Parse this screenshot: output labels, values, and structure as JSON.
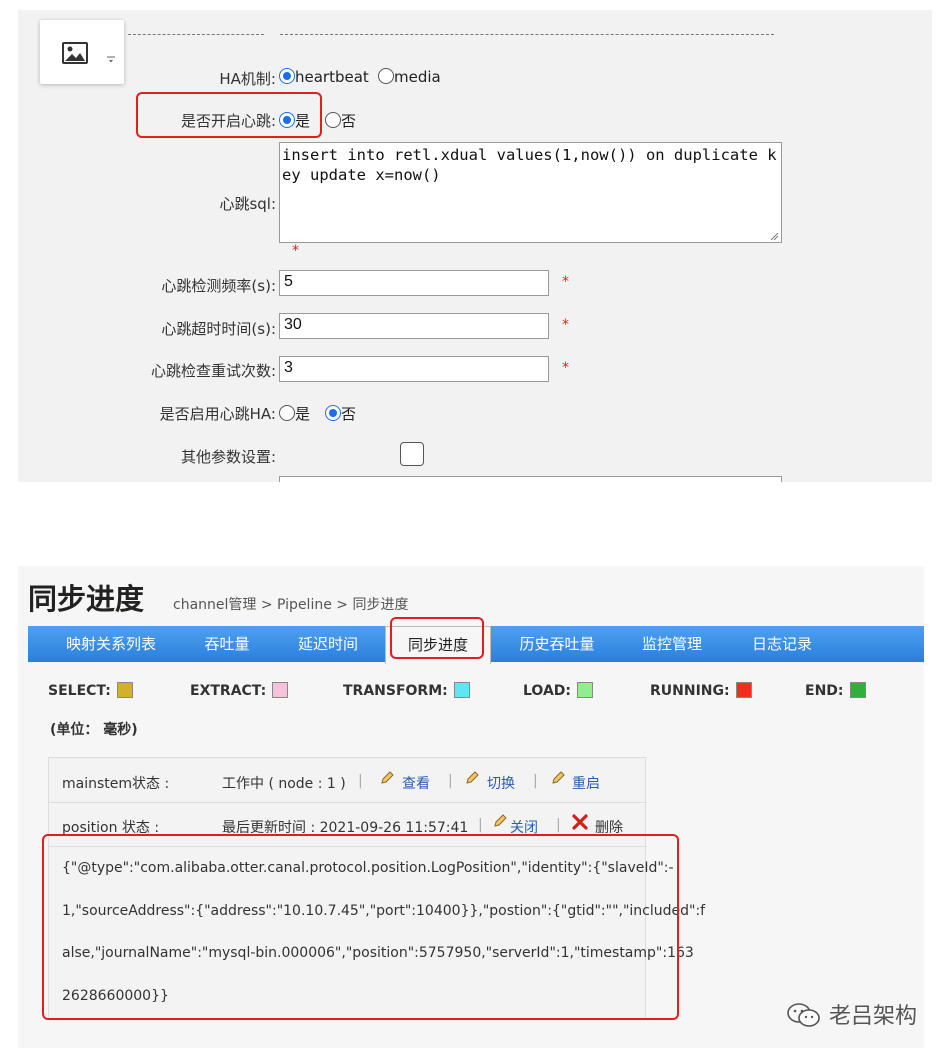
{
  "ha_form": {
    "ha_mechanism": {
      "label": "HA机制:",
      "options": [
        "heartbeat",
        "media"
      ],
      "selected": "heartbeat"
    },
    "enable_heartbeat": {
      "label": "是否开启心跳:",
      "options": [
        "是",
        "否"
      ],
      "selected": "是"
    },
    "heartbeat_sql": {
      "label": "心跳sql:",
      "value": "insert into retl.xdual values(1,now()) on duplicate key update x=now()"
    },
    "heartbeat_interval": {
      "label": "心跳检测频率(s):",
      "value": "5"
    },
    "heartbeat_timeout": {
      "label": "心跳超时时间(s):",
      "value": "30"
    },
    "heartbeat_retry": {
      "label": "心跳检查重试次数:",
      "value": "3"
    },
    "enable_heartbeat_ha": {
      "label": "是否启用心跳HA:",
      "options": [
        "是",
        "否"
      ],
      "selected": "否"
    },
    "other_params": {
      "label": "其他参数设置:",
      "checked": false
    },
    "required_mark": "*"
  },
  "page": {
    "title": "同步进度",
    "breadcrumb": "channel管理 > Pipeline > 同步进度"
  },
  "tabs": [
    {
      "label": "映射关系列表",
      "active": false
    },
    {
      "label": "吞吐量",
      "active": false
    },
    {
      "label": "延迟时间",
      "active": false
    },
    {
      "label": "同步进度",
      "active": true
    },
    {
      "label": "历史吞吐量",
      "active": false
    },
    {
      "label": "监控管理",
      "active": false
    },
    {
      "label": "日志记录",
      "active": false
    }
  ],
  "legend": [
    {
      "label": "SELECT:",
      "color": "#d4b02a"
    },
    {
      "label": "EXTRACT:",
      "color": "#f7c1dc"
    },
    {
      "label": "TRANSFORM:",
      "color": "#5fe6f5"
    },
    {
      "label": "LOAD:",
      "color": "#8ef08a"
    },
    {
      "label": "RUNNING:",
      "color": "#f02f1f"
    },
    {
      "label": "END:",
      "color": "#2fb03a"
    }
  ],
  "unit_note": "(单位： 毫秒)",
  "mainstem": {
    "label": "mainstem状态 :",
    "status": "工作中 ( node : 1 )",
    "actions": [
      "查看",
      "切换",
      "重启"
    ]
  },
  "position_status": {
    "label": "position 状态 :",
    "updated": "最后更新时间 : 2021-09-26 11:57:41",
    "actions": [
      "关闭",
      "删除"
    ]
  },
  "position_json_lines": [
    "{\"@type\":\"com.alibaba.otter.canal.protocol.position.LogPosition\",\"identity\":{\"slaveId\":-",
    "1,\"sourceAddress\":{\"address\":\"10.10.7.45\",\"port\":10400}},\"postion\":{\"gtid\":\"\",\"included\":f",
    "alse,\"journalName\":\"mysql-bin.000006\",\"position\":5757950,\"serverId\":1,\"timestamp\":163",
    "2628660000}}"
  ],
  "watermark": "老吕架构",
  "icons": {
    "image": "image-icon",
    "dropdown": "chevron-down-icon",
    "edit": "pencil-icon",
    "delete": "x-icon",
    "wechat": "wechat-icon"
  }
}
